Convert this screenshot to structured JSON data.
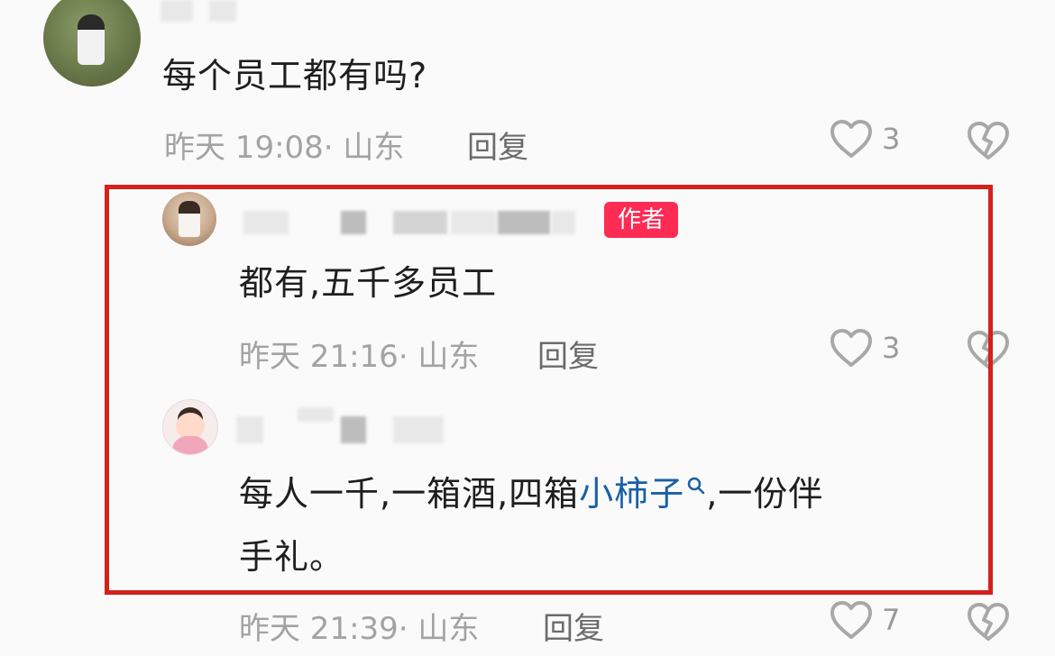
{
  "comments": [
    {
      "text": "每个员工都有吗?",
      "time": "昨天 19:08",
      "location": "· 山东",
      "reply_label": "回复",
      "likes": "3"
    }
  ],
  "replies": [
    {
      "badge": "作者",
      "text": "都有,五千多员工",
      "time": "昨天 21:16",
      "location": "· 山东",
      "reply_label": "回复",
      "likes": "3"
    },
    {
      "text_before": "每人一千,一箱酒,四箱",
      "link": "小柿子",
      "text_after_line1": ",一份伴",
      "text_line2": "手礼。",
      "time": "昨天 21:39",
      "location": "· 山东",
      "reply_label": "回复",
      "likes": "7"
    }
  ],
  "icons": {
    "like": "heart-outline-icon",
    "dislike": "broken-heart-icon",
    "link_search": "search-icon"
  },
  "colors": {
    "badge_bg": "#fe2c55",
    "link": "#1a5fa8",
    "highlight_border": "#d4211d",
    "meta_text": "#a3a3a3"
  }
}
